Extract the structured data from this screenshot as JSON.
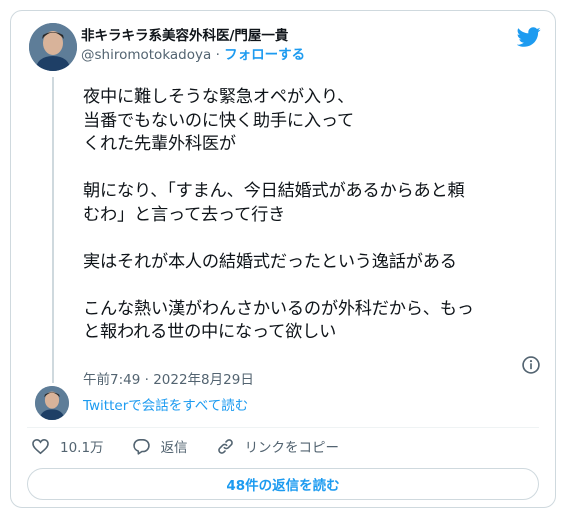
{
  "author": {
    "display_name": "非キラキラ系美容外科医/門屋一貴",
    "handle": "@shiromotokadoya",
    "separator": "·",
    "follow_label": "フォローする"
  },
  "tweet": {
    "paragraphs": [
      "夜中に難しそうな緊急オペが入り、\n当番でもないのに快く助手に入って\nくれた先輩外科医が",
      "朝になり、「すまん、今日結婚式があるからあと頼\nむわ」と言って去って行き",
      "実はそれが本人の結婚式だったという逸話がある",
      "こんな熱い漢がわんさかいるのが外科だから、もっ\nと報われる世の中になって欲しい"
    ],
    "timestamp": "午前7:49 · 2022年8月29日"
  },
  "conversation_link": "Twitterで会話をすべて読む",
  "actions": {
    "like_count": "10.1万",
    "reply_label": "返信",
    "copy_link_label": "リンクをコピー"
  },
  "read_replies_label": "48件の返信を読む",
  "colors": {
    "accent": "#1d9bf0",
    "secondary_text": "#536471",
    "border": "#cfd9de"
  },
  "icons": [
    "twitter-bird-icon",
    "info-icon",
    "heart-icon",
    "reply-icon",
    "link-icon"
  ]
}
